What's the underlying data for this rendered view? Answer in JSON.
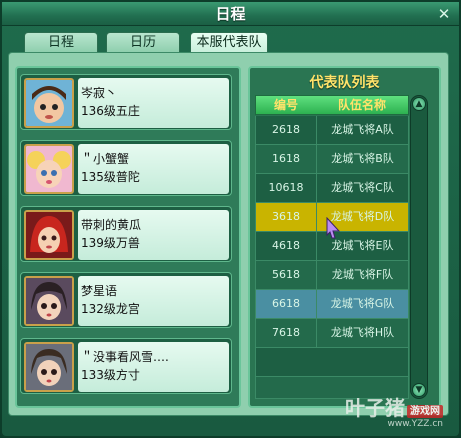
{
  "window": {
    "title": "日程"
  },
  "tabs": [
    {
      "label": "日程"
    },
    {
      "label": "日历"
    },
    {
      "label": "本服代表队"
    }
  ],
  "members": [
    {
      "name": "岑寂丶",
      "level": "136级五庄"
    },
    {
      "name": "＂小蟹蟹",
      "level": "135级普陀"
    },
    {
      "name": "带刺的黄瓜",
      "level": "139级万兽"
    },
    {
      "name": "梦星语",
      "level": "132级龙宫"
    },
    {
      "name": "＂没事看风雪….",
      "level": "133级方寸"
    }
  ],
  "team_list": {
    "title": "代表队列表",
    "columns": [
      "编号",
      "队伍名称"
    ],
    "rows": [
      {
        "id": "2618",
        "name": "龙城飞将A队"
      },
      {
        "id": "1618",
        "name": "龙城飞将B队"
      },
      {
        "id": "10618",
        "name": "龙城飞将C队"
      },
      {
        "id": "3618",
        "name": "龙城飞将D队"
      },
      {
        "id": "4618",
        "name": "龙城飞将E队"
      },
      {
        "id": "5618",
        "name": "龙城飞将F队"
      },
      {
        "id": "6618",
        "name": "龙城飞将G队"
      },
      {
        "id": "7618",
        "name": "龙城飞将H队"
      }
    ],
    "selected_row": 3,
    "hover_row": 6
  },
  "watermark": {
    "main": "叶子猪",
    "badge": "游戏网",
    "url": "www.YZZ.cn"
  },
  "colors": {
    "accent": "#c9b400",
    "header": "#2db150",
    "panel": "#1f6b4c"
  }
}
